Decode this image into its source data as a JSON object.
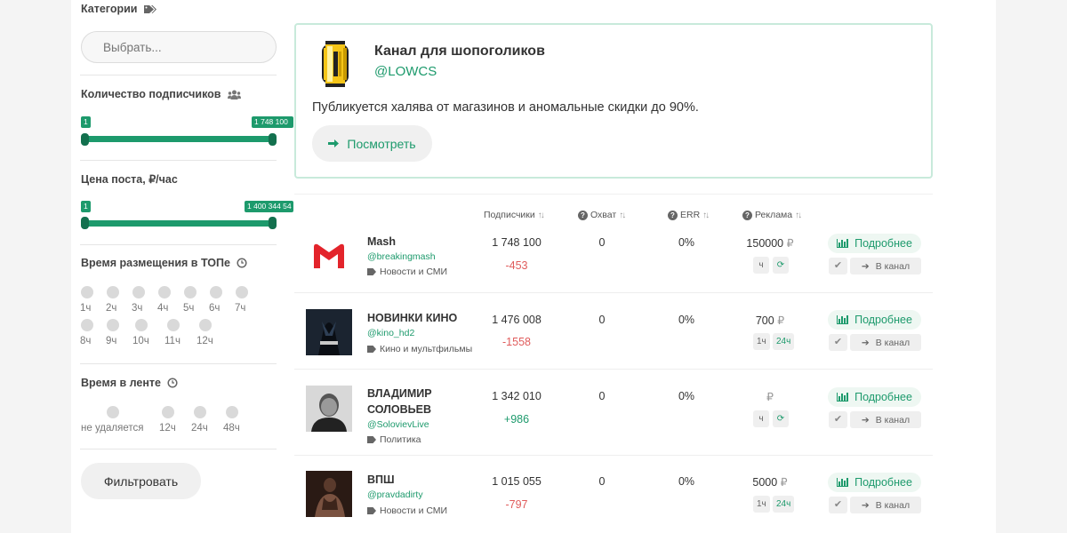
{
  "filters": {
    "categories_title": "Категории",
    "categories_placeholder": "Выбрать...",
    "subscribers_title": "Количество подписчиков",
    "subscribers_min": "1",
    "subscribers_max": "1 748 100",
    "price_title": "Цена поста, ₽/час",
    "price_min": "1",
    "price_max": "1 400 344 54",
    "top_time_title": "Время размещения в ТОПе",
    "top_time_options": [
      "1ч",
      "2ч",
      "3ч",
      "4ч",
      "5ч",
      "6ч",
      "7ч",
      "8ч",
      "9ч",
      "10ч",
      "11ч",
      "12ч"
    ],
    "feed_time_title": "Время в ленте",
    "feed_time_options": [
      "не удаляется",
      "12ч",
      "24ч",
      "48ч"
    ],
    "filter_button": "Фильтровать"
  },
  "featured": {
    "title": "Канал для шопоголиков",
    "handle": "@LOWCS",
    "description": "Публикуется халява от магазинов и аномальные скидки до 90%.",
    "button": "Посмотреть"
  },
  "table": {
    "headers": {
      "subscribers": "Подписчики",
      "reach": "Охват",
      "err": "ERR",
      "ads": "Реклама"
    },
    "rows": [
      {
        "name": "Mash",
        "handle": "@breakingmash",
        "category": "Новости и СМИ",
        "subscribers": "1 748 100",
        "delta": "-453",
        "reach": "0",
        "err": "0%",
        "price": "150000",
        "rub": "₽",
        "chip1": "ч",
        "details": "Подробнее",
        "go": "В канал"
      },
      {
        "name": "НОВИНКИ КИНО",
        "handle": "@kino_hd2",
        "category": "Кино и мультфильмы",
        "subscribers": "1 476 008",
        "delta": "-1558",
        "reach": "0",
        "err": "0%",
        "price": "700",
        "rub": "₽",
        "chip1": "1ч",
        "chip2": "24ч",
        "details": "Подробнее",
        "go": "В канал"
      },
      {
        "name": "ВЛАДИМИР СОЛОВЬЕВ",
        "handle": "@SolovievLive",
        "category": "Политика",
        "subscribers": "1 342 010",
        "delta": "+986",
        "reach": "0",
        "err": "0%",
        "price": "",
        "rub": "₽",
        "chip1": "ч",
        "details": "Подробнее",
        "go": "В канал"
      },
      {
        "name": "ВПШ",
        "handle": "@pravdadirty",
        "category": "Новости и СМИ",
        "subscribers": "1 015 055",
        "delta": "-797",
        "reach": "0",
        "err": "0%",
        "price": "5000",
        "rub": "₽",
        "chip1": "1ч",
        "chip2": "24ч",
        "details": "Подробнее",
        "go": "В канал"
      }
    ]
  },
  "colors": {
    "accent": "#1d9a6c",
    "negative": "#e05c5c",
    "border": "#c8eadb"
  }
}
